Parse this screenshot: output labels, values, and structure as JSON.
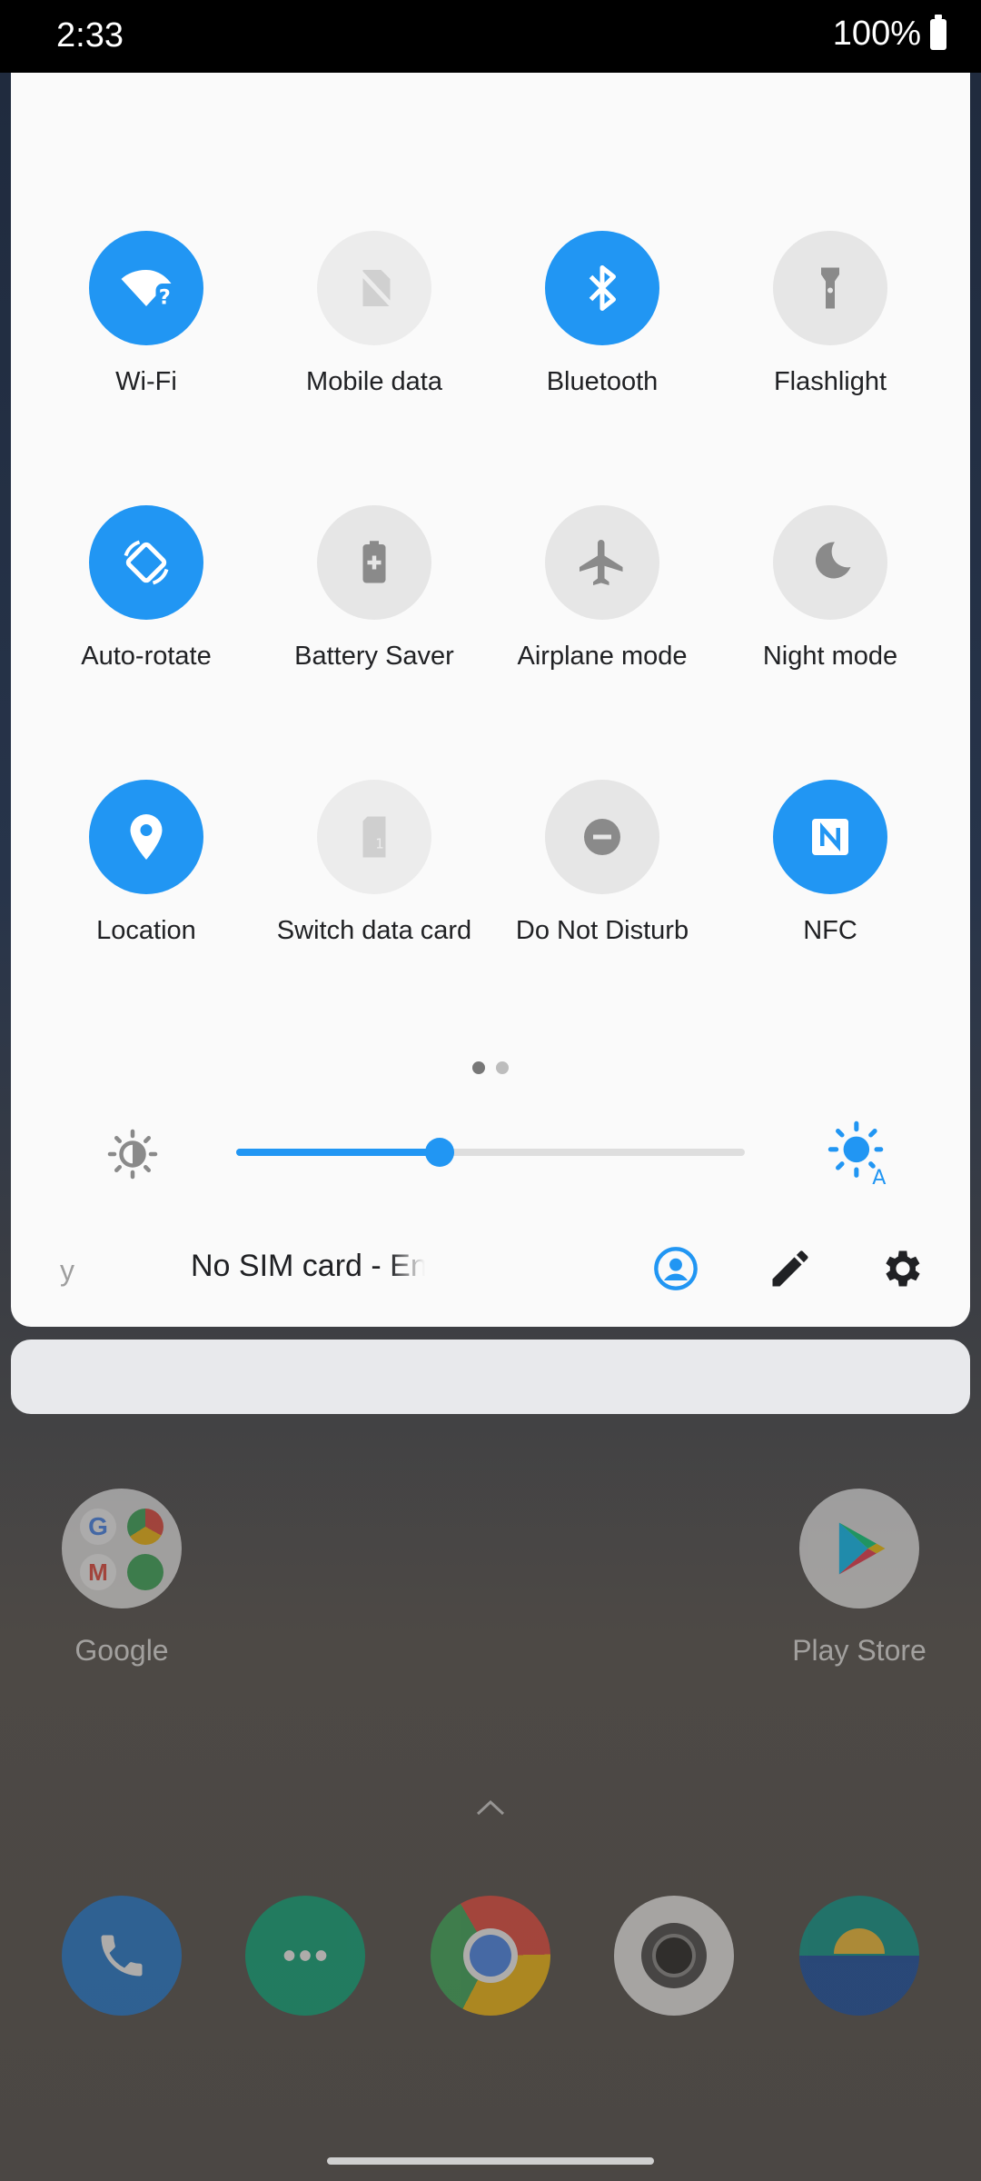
{
  "status_bar": {
    "time": "2:33",
    "battery": "100%"
  },
  "colors": {
    "accent": "#2196f3",
    "tile_off": "#e6e6e6"
  },
  "quick_settings": {
    "tiles": [
      {
        "label": "Wi-Fi",
        "icon": "wifi-icon",
        "state": "on"
      },
      {
        "label": "Mobile data",
        "icon": "mobile-data-icon",
        "state": "disabled"
      },
      {
        "label": "Bluetooth",
        "icon": "bluetooth-icon",
        "state": "on"
      },
      {
        "label": "Flashlight",
        "icon": "flashlight-icon",
        "state": "off"
      },
      {
        "label": "Auto-rotate",
        "icon": "auto-rotate-icon",
        "state": "on"
      },
      {
        "label": "Battery Saver",
        "icon": "battery-saver-icon",
        "state": "off"
      },
      {
        "label": "Airplane mode",
        "icon": "airplane-icon",
        "state": "off"
      },
      {
        "label": "Night mode",
        "icon": "moon-icon",
        "state": "off"
      },
      {
        "label": "Location",
        "icon": "location-icon",
        "state": "on"
      },
      {
        "label": "Switch data card",
        "icon": "sim-card-icon",
        "state": "disabled"
      },
      {
        "label": "Do Not Disturb",
        "icon": "do-not-disturb-icon",
        "state": "off"
      },
      {
        "label": "NFC",
        "icon": "nfc-icon",
        "state": "on"
      }
    ],
    "page_indicator": {
      "pages": 2,
      "current": 1
    },
    "brightness": {
      "level": 0.4,
      "auto": true
    },
    "footer": {
      "fragment": "y",
      "carrier_text": "No SIM card - En"
    }
  },
  "home": {
    "apps": [
      {
        "label": "Google",
        "icon": "google-folder-icon"
      },
      {
        "label": "Play Store",
        "icon": "play-store-icon"
      }
    ],
    "dock": [
      {
        "icon": "phone-icon"
      },
      {
        "icon": "messages-icon"
      },
      {
        "icon": "chrome-icon"
      },
      {
        "icon": "camera-icon"
      },
      {
        "icon": "wallpaper-icon"
      }
    ]
  }
}
